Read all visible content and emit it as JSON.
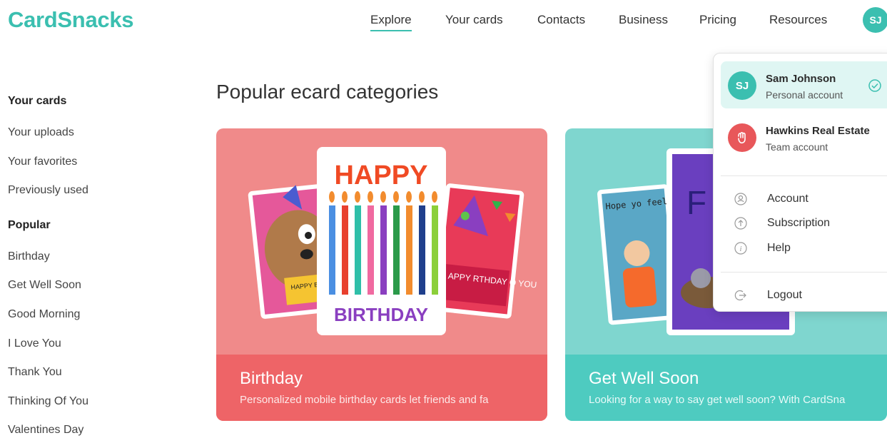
{
  "brand": {
    "logo": "CardSnacks",
    "accent": "#3bbfb0"
  },
  "nav": {
    "items": [
      {
        "label": "Explore",
        "active": true
      },
      {
        "label": "Your cards"
      },
      {
        "label": "Contacts"
      },
      {
        "label": "Business"
      },
      {
        "label": "Pricing"
      },
      {
        "label": "Resources"
      }
    ],
    "avatar_initials": "SJ"
  },
  "sidebar": {
    "sections": [
      {
        "heading": "Your cards",
        "items": [
          "Your uploads",
          "Your favorites",
          "Previously used"
        ]
      },
      {
        "heading": "Popular",
        "items": [
          "Birthday",
          "Get Well Soon",
          "Good Morning",
          "I Love You",
          "Thank You",
          "Thinking Of You",
          "Valentines Day"
        ]
      }
    ]
  },
  "main": {
    "title": "Popular ecard categories",
    "cards": [
      {
        "title": "Birthday",
        "description": "Personalized mobile birthday cards let friends and fa",
        "art_text": {
          "top": "HAPPY",
          "bottom": "BIRTHDAY",
          "left_card": "HAPPY BIRTHD TO YO",
          "right_card": "APPY RTHDAY O YOU"
        }
      },
      {
        "title": "Get Well Soon",
        "description": "Looking for a way to say get well soon? With CardSna",
        "art_text": {
          "left_card": "Hope yo feel bet",
          "middle_card": "F Be"
        }
      }
    ]
  },
  "dropdown": {
    "accounts": [
      {
        "initials": "SJ",
        "name": "Sam Johnson",
        "type": "Personal account",
        "selected": true,
        "color": "#3bbfb0"
      },
      {
        "name": "Hawkins Real Estate",
        "type": "Team account",
        "selected": false,
        "color": "#e8575a",
        "icon": "hand-logo-icon"
      }
    ],
    "menu": [
      {
        "label": "Account",
        "icon": "account-icon"
      },
      {
        "label": "Subscription",
        "icon": "subscription-icon"
      },
      {
        "label": "Help",
        "icon": "help-icon"
      }
    ],
    "logout": {
      "label": "Logout",
      "icon": "logout-icon"
    }
  }
}
